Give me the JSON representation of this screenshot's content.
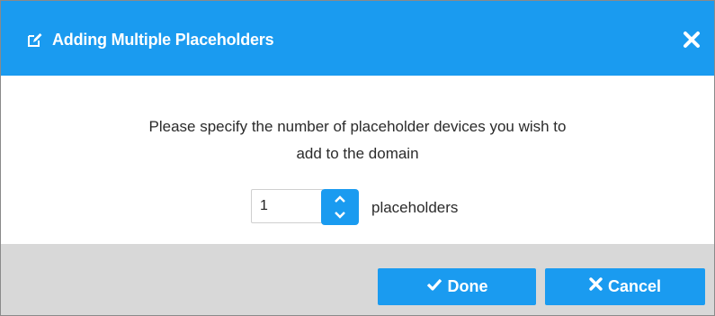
{
  "dialog": {
    "title": "Adding Multiple Placeholders",
    "header_icon": "edit-icon",
    "close_icon": "close-icon",
    "accent_color": "#1a9bf0",
    "footer_color": "#d8d8d8"
  },
  "body": {
    "message_line1": "Please specify the number of placeholder devices you wish to",
    "message_line2": "add to the domain",
    "quantity": {
      "value": "1",
      "suffix": "placeholders",
      "increment_icon": "chevron-up-icon",
      "decrement_icon": "chevron-down-icon"
    }
  },
  "footer": {
    "done_label": "Done",
    "done_icon": "checkmark-icon",
    "cancel_label": "Cancel",
    "cancel_icon": "x-icon"
  }
}
